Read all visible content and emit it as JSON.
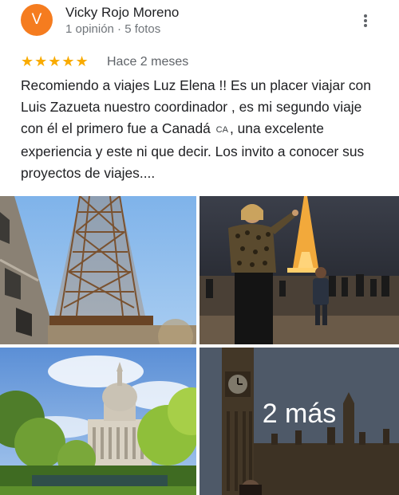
{
  "reviewer": {
    "initial": "V",
    "avatar_color": "#f57c1f",
    "name": "Vicky Rojo Moreno",
    "meta": "1 opinión · 5 fotos"
  },
  "review": {
    "rating": 5,
    "stars": "★★★★★",
    "star_color": "#f9ab00",
    "time": "Hace 2 meses",
    "text_before_flag": "Recomiendo a viajes Luz Elena !! Es un placer viajar con Luis Zazueta nuestro coordinador , es mi segundo viaje con él el primero fue a Canadá",
    "flag": "CA",
    "text_after_flag": ", una excelente experiencia y este ni que decir. Los invito a conocer sus proyectos de viajes...."
  },
  "photos": {
    "more_label": "2 más",
    "items": [
      "eiffel-tower-closeup",
      "woman-eiffel-tower-night",
      "st-pauls-cathedral",
      "big-ben"
    ]
  },
  "icons": {
    "menu": "more-vert-icon"
  }
}
